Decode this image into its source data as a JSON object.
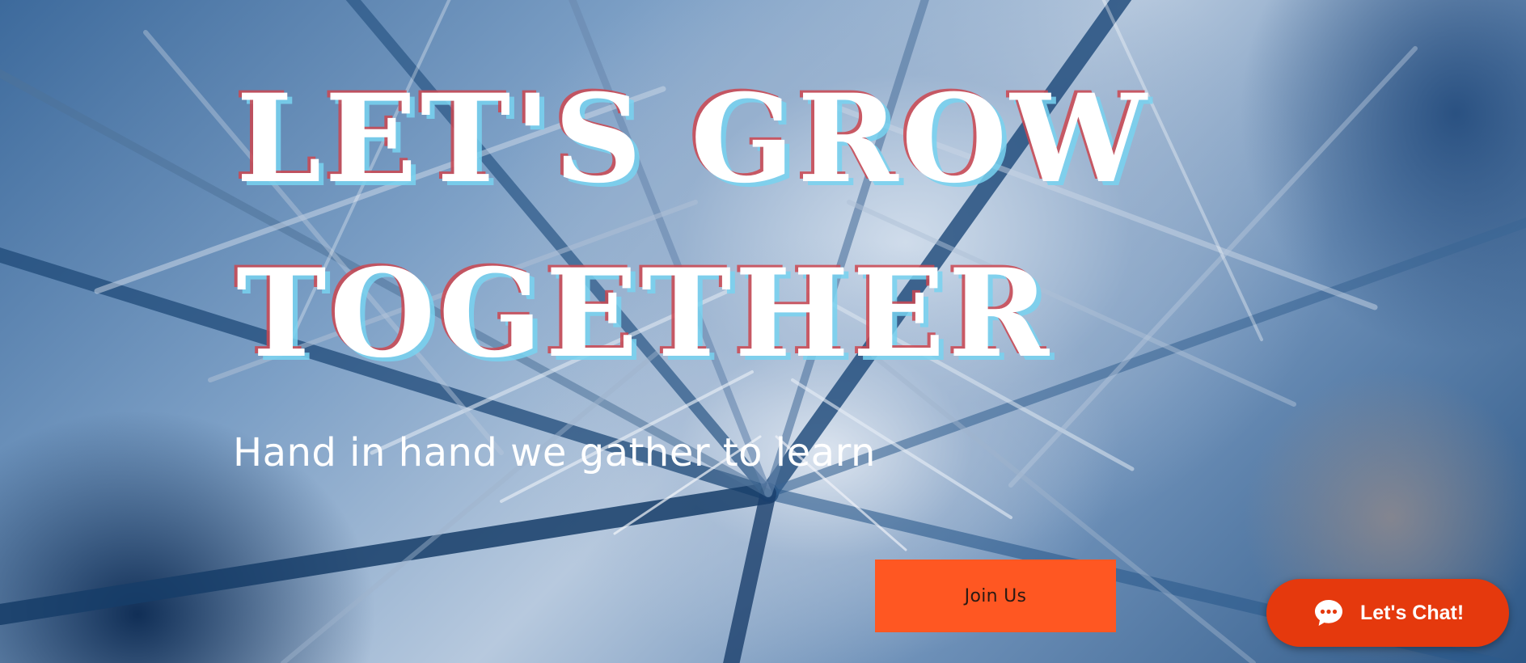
{
  "hero": {
    "headline_line1": "LET'S GROW",
    "headline_line2": "TOGETHER",
    "subheading": "Hand in hand we gather to learn",
    "join_button_label": "Join Us"
  },
  "chat_widget": {
    "label": "Let's Chat!",
    "icon": "chat-bubble-icon"
  },
  "colors": {
    "button_accent": "#ff5722",
    "chat_accent": "#e5390d",
    "headline_text": "#ffffff",
    "headline_shadow_red": "#cd4650",
    "headline_shadow_cyan": "#78d2f0"
  }
}
